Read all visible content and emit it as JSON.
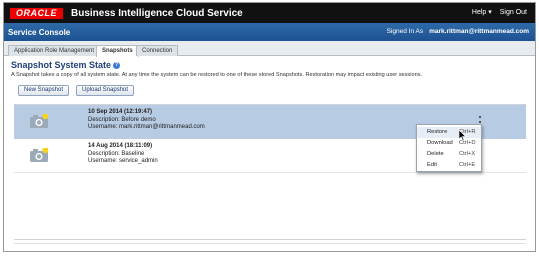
{
  "header": {
    "logo_text": "ORACLE",
    "product": "Business Intelligence Cloud Service",
    "links": [
      "Help ▾",
      "Sign Out"
    ]
  },
  "service_bar": {
    "title": "Service Console",
    "signed_in_label": "Signed In As",
    "user": "mark.rittman@rittmanmead.com"
  },
  "tabs": [
    {
      "label": "Application Role Management",
      "active": false
    },
    {
      "label": "Snapshots",
      "active": true
    },
    {
      "label": "Connection",
      "active": false
    }
  ],
  "panel": {
    "title": "Snapshot System State",
    "help_icon": "?",
    "description": "A Snapshot takes a copy of all system state. At any time the system can be restored to one of these stored Snapshots. Restoration may impact existing user sessions."
  },
  "buttons": {
    "new_snapshot": "New Snapshot",
    "upload_snapshot": "Upload Snapshot"
  },
  "snapshots": [
    {
      "timestamp": "10 Sep 2014 (12:19:47)",
      "description": "Description: Before demo",
      "username": "Username: mark.rittman@rittmanmead.com",
      "selected": true,
      "icon": "camera-icon"
    },
    {
      "timestamp": "14 Aug 2014 (18:11:09)",
      "description": "Description: Baseline",
      "username": "Username: service_admin",
      "selected": false,
      "icon": "camera-icon"
    }
  ],
  "context_menu": [
    {
      "label": "Restore",
      "shortcut": "Ctrl+R",
      "highlighted": true
    },
    {
      "label": "Download",
      "shortcut": "Ctrl+D",
      "highlighted": false
    },
    {
      "label": "Delete",
      "shortcut": "Ctrl+X",
      "highlighted": false
    },
    {
      "label": "Edit",
      "shortcut": "Ctrl+E",
      "highlighted": false
    }
  ],
  "colors": {
    "topbar": "#111111",
    "service_bar": "#1d5291",
    "selected_row": "#b7cbe3",
    "panel_title": "#1f3f7a",
    "oracle_red": "#e00000"
  }
}
